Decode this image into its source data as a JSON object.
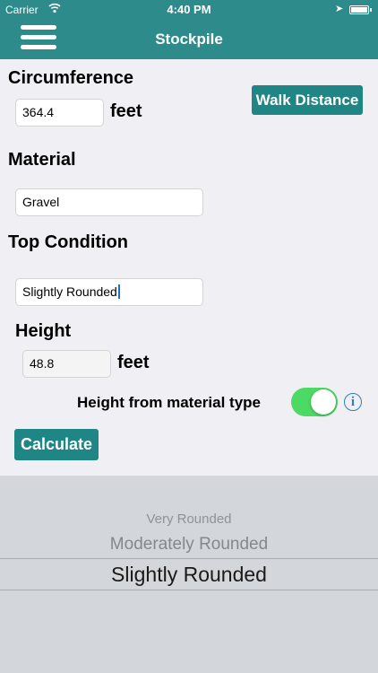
{
  "status_bar": {
    "carrier": "Carrier",
    "time": "4:40 PM",
    "battery_level": 0.95
  },
  "nav": {
    "title": "Stockpile",
    "menu_icon": "hamburger-menu-icon"
  },
  "circumference": {
    "label": "Circumference",
    "value": "364.4",
    "unit": "feet",
    "walk_button": "Walk Distance"
  },
  "material": {
    "label": "Material",
    "value": "Gravel"
  },
  "top_condition": {
    "label": "Top Condition",
    "value": "Slightly Rounded"
  },
  "height": {
    "label": "Height",
    "value": "48.8",
    "unit": "feet"
  },
  "height_from_material": {
    "label": "Height from material type",
    "enabled": true
  },
  "calculate_button": "Calculate",
  "picker": {
    "options": [
      "Very Rounded",
      "Moderately Rounded",
      "Slightly Rounded"
    ],
    "selected": "Slightly Rounded"
  },
  "colors": {
    "nav_bar": "#2e8b8b",
    "button": "#1f8585",
    "toggle_on": "#4cd964",
    "info_icon": "#2e7fb8"
  }
}
